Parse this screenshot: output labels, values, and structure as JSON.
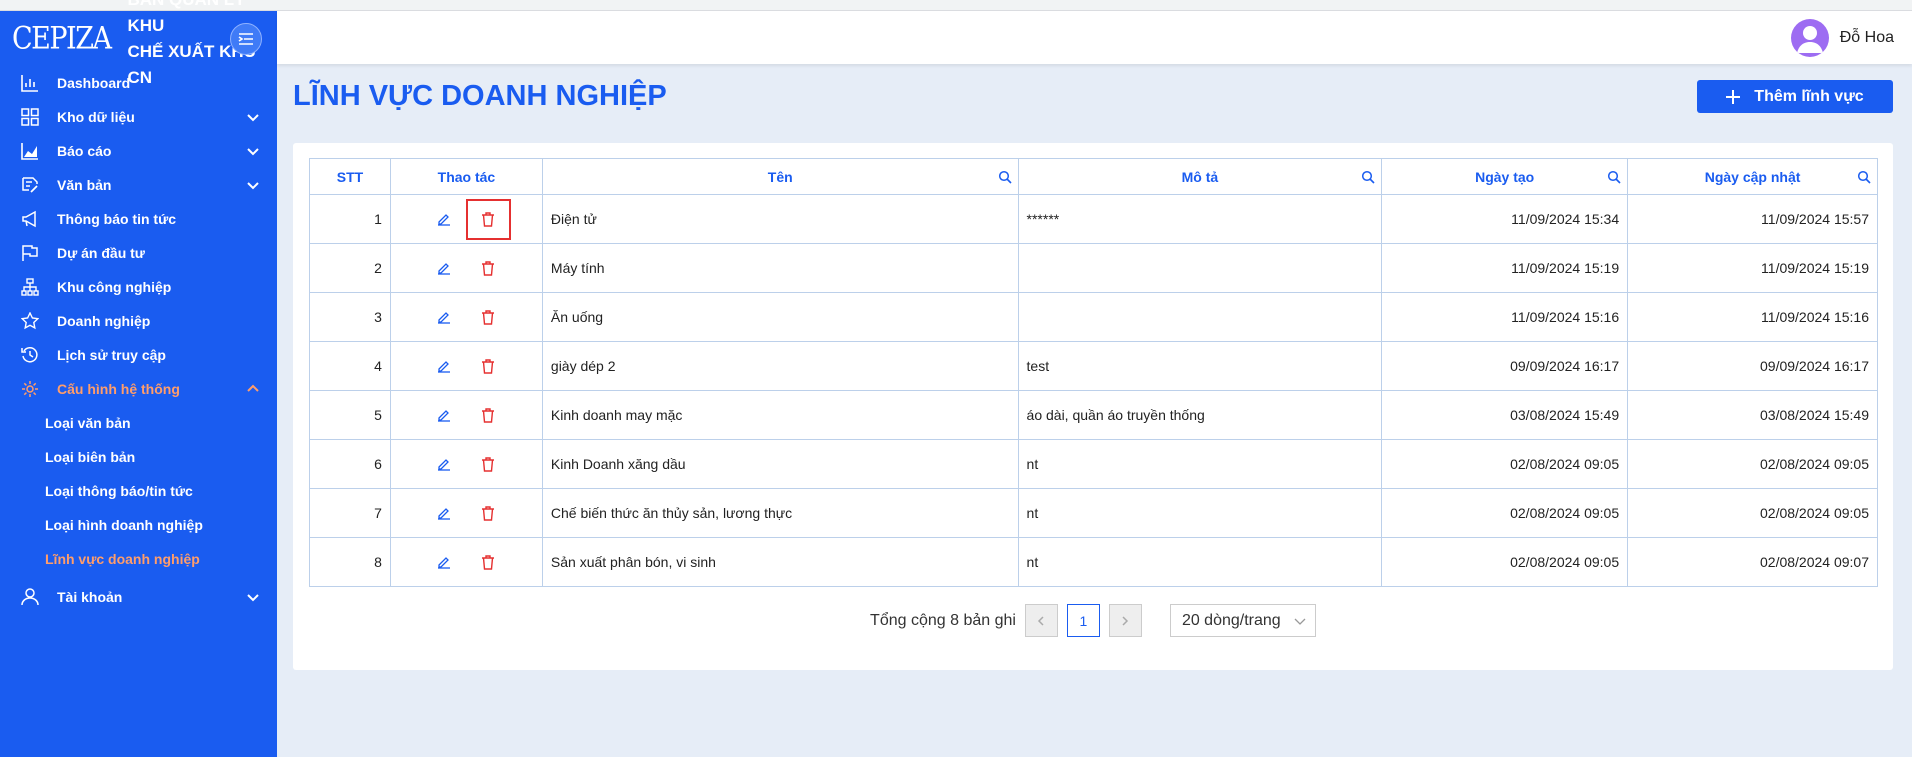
{
  "app": {
    "logo_text": "CEPIZA",
    "brand_line1": "BAN QUẢN LÝ KHU",
    "brand_line2": "CHẾ XUẤT KHU CN"
  },
  "sidebar": {
    "items": [
      {
        "label": "Dashboard",
        "icon": "chart-icon"
      },
      {
        "label": "Kho dữ liệu",
        "icon": "grid-icon"
      },
      {
        "label": "Báo cáo",
        "icon": "area-chart-icon"
      },
      {
        "label": "Văn bản",
        "icon": "document-icon"
      },
      {
        "label": "Thông báo tin tức",
        "icon": "megaphone-icon"
      },
      {
        "label": "Dự án đầu tư",
        "icon": "flag-icon"
      },
      {
        "label": "Khu công nghiệp",
        "icon": "hierarchy-icon"
      },
      {
        "label": "Doanh nghiệp",
        "icon": "star-icon"
      },
      {
        "label": "Lịch sử truy cập",
        "icon": "history-icon"
      },
      {
        "label": "Cấu hình hệ thống",
        "icon": "gear-icon"
      }
    ],
    "subitems": [
      {
        "label": "Loại văn bản"
      },
      {
        "label": "Loại biên bản"
      },
      {
        "label": "Loại thông báo/tin tức"
      },
      {
        "label": "Loại hình doanh nghiệp"
      },
      {
        "label": "Lĩnh vực doanh nghiệp"
      }
    ],
    "account": {
      "label": "Tài khoản",
      "icon": "user-icon"
    }
  },
  "header": {
    "user_name": "Đỗ Hoa"
  },
  "page": {
    "title": "LĨNH VỰC DOANH NGHIỆP",
    "add_button": "Thêm lĩnh vực"
  },
  "table": {
    "columns": {
      "stt": "STT",
      "actions": "Thao tác",
      "name": "Tên",
      "description": "Mô tả",
      "created": "Ngày tạo",
      "updated": "Ngày cập nhật"
    },
    "rows": [
      {
        "stt": "1",
        "name": "Điện tử",
        "description": "******",
        "created": "11/09/2024 15:34",
        "updated": "11/09/2024 15:57"
      },
      {
        "stt": "2",
        "name": "Máy tính",
        "description": "",
        "created": "11/09/2024 15:19",
        "updated": "11/09/2024 15:19"
      },
      {
        "stt": "3",
        "name": "Ăn uống",
        "description": "",
        "created": "11/09/2024 15:16",
        "updated": "11/09/2024 15:16"
      },
      {
        "stt": "4",
        "name": "giày dép 2",
        "description": "test",
        "created": "09/09/2024 16:17",
        "updated": "09/09/2024 16:17"
      },
      {
        "stt": "5",
        "name": "Kinh doanh may mặc",
        "description": "áo dài, quần áo truyền thống",
        "created": "03/08/2024 15:49",
        "updated": "03/08/2024 15:49"
      },
      {
        "stt": "6",
        "name": "Kinh Doanh xăng dầu",
        "description": "nt",
        "created": "02/08/2024 09:05",
        "updated": "02/08/2024 09:05"
      },
      {
        "stt": "7",
        "name": "Chế biến thức ăn thủy sản, lương thực",
        "description": "nt",
        "created": "02/08/2024 09:05",
        "updated": "02/08/2024 09:05"
      },
      {
        "stt": "8",
        "name": "Sản xuất phân bón, vi sinh",
        "description": "nt",
        "created": "02/08/2024 09:05",
        "updated": "02/08/2024 09:07"
      }
    ]
  },
  "pagination": {
    "total_text": "Tổng cộng 8 bản ghi",
    "current_page": "1",
    "page_size": "20 dòng/trang"
  },
  "colors": {
    "primary": "#1a5cf0",
    "active_menu": "#ff9d6b",
    "delete": "#e53030"
  }
}
